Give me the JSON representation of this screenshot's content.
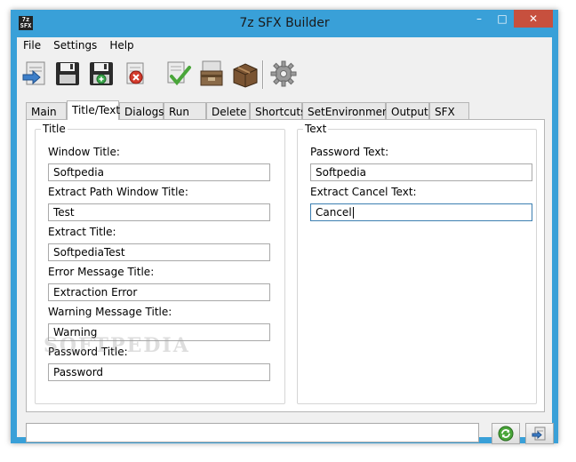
{
  "window": {
    "title": "7z SFX Builder",
    "icon_text_top": "7z",
    "icon_text_bottom": "SFX",
    "controls": {
      "minimize": "–",
      "maximize": "□",
      "close": "✕"
    }
  },
  "menu": [
    {
      "label": "File"
    },
    {
      "label": "Settings"
    },
    {
      "label": "Help"
    }
  ],
  "toolbar": {
    "buttons": [
      {
        "name": "open-project-icon"
      },
      {
        "name": "save-icon"
      },
      {
        "name": "save-as-icon"
      },
      {
        "name": "delete-icon"
      },
      {
        "name": "check-icon"
      },
      {
        "name": "archive-icon"
      },
      {
        "name": "box-icon"
      },
      {
        "name": "gear-icon"
      }
    ]
  },
  "tabs": [
    {
      "label": "Main"
    },
    {
      "label": "Title/Text"
    },
    {
      "label": "Dialogs"
    },
    {
      "label": "Run"
    },
    {
      "label": "Delete"
    },
    {
      "label": "Shortcuts"
    },
    {
      "label": "SetEnvironment"
    },
    {
      "label": "Output"
    },
    {
      "label": "SFX"
    }
  ],
  "title_group": {
    "heading": "Title",
    "fields": [
      {
        "label": "Window Title:",
        "value": "Softpedia"
      },
      {
        "label": "Extract Path Window Title:",
        "value": "Test"
      },
      {
        "label": "Extract Title:",
        "value": "SoftpediaTest"
      },
      {
        "label": "Error Message Title:",
        "value": "Extraction Error"
      },
      {
        "label": "Warning Message Title:",
        "value": "Warning"
      },
      {
        "label": "Password Title:",
        "value": "Password"
      }
    ]
  },
  "text_group": {
    "heading": "Text",
    "fields": [
      {
        "label": "Password Text:",
        "value": "Softpedia"
      },
      {
        "label": "Extract Cancel Text:",
        "value": "Cancel"
      }
    ]
  },
  "status": {
    "value": ""
  },
  "watermark": "SOFTPEDIA",
  "colors": {
    "frame": "#39a0d8",
    "close_button": "#c7503e",
    "client": "#f0f0f0"
  }
}
